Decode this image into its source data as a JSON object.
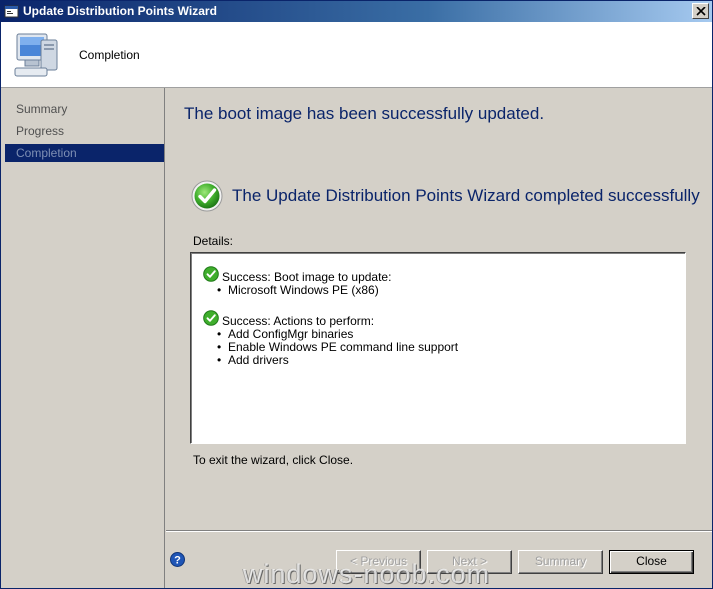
{
  "window": {
    "title": "Update Distribution Points Wizard"
  },
  "header": {
    "title": "Completion"
  },
  "nav": {
    "items": [
      {
        "label": "Summary"
      },
      {
        "label": "Progress"
      },
      {
        "label": "Completion"
      }
    ],
    "active": "Completion"
  },
  "main": {
    "heading": "The boot image has been successfully updated.",
    "success_heading": "The Update Distribution Points Wizard completed successfully",
    "details_label": "Details:",
    "details": [
      {
        "head": "Success: Boot image to update:",
        "items": [
          "Microsoft Windows PE (x86)"
        ]
      },
      {
        "head": "Success: Actions to perform:",
        "items": [
          "Add ConfigMgr binaries",
          "Enable Windows PE command line support",
          "Add drivers"
        ]
      }
    ],
    "exit_text": "To exit the wizard, click Close."
  },
  "buttons": {
    "previous": "< Previous",
    "next": "Next >",
    "summary": "Summary",
    "close": "Close"
  },
  "watermark": "windows-noob.com",
  "icons": {
    "title": "wizard-app-icon",
    "header": "computer-icon",
    "success": "green-check-icon",
    "help": "help-icon",
    "close": "close-x-icon"
  },
  "colors": {
    "accent": "#0a246a",
    "success": "#2f9e2f"
  }
}
